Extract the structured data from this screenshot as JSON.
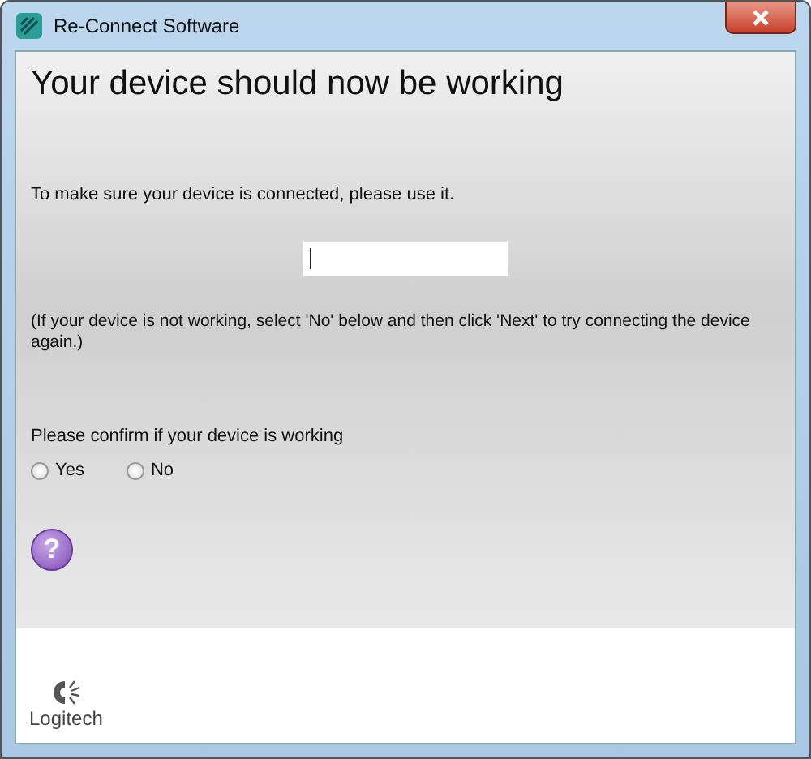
{
  "window": {
    "title": "Re-Connect Software"
  },
  "heading": "Your device should now be working",
  "instruction": "To make sure your device is connected, please use it.",
  "note": "(If your device is not working, select 'No' below and then click 'Next' to try connecting the device again.)",
  "confirm": {
    "label": "Please confirm if your device is working",
    "options": [
      {
        "label": "Yes",
        "selected": false
      },
      {
        "label": "No",
        "selected": false
      }
    ]
  },
  "help": {
    "glyph": "?"
  },
  "footer": {
    "brand": "Logitech"
  }
}
